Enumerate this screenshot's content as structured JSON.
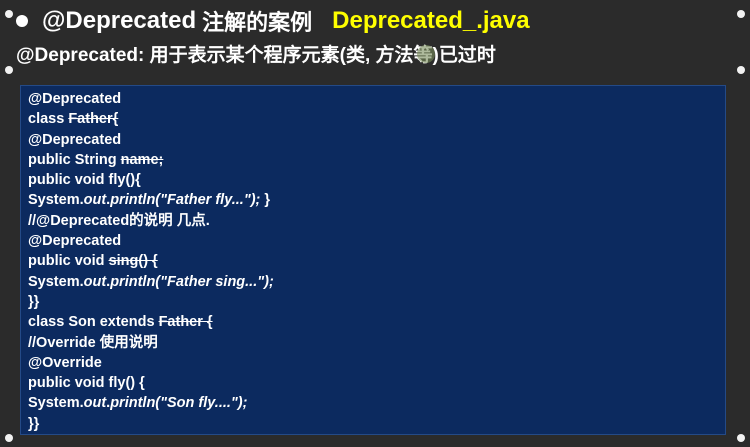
{
  "header": {
    "title_main": "@Deprecated",
    "title_cn": "注解的案例",
    "title_file": "Deprecated_.java",
    "subtitle_prefix": "@Deprecated:",
    "subtitle_text": "用于表示某个程序元素(类, 方法等)已过时"
  },
  "code": {
    "l1": "@Deprecated",
    "l2a": "class ",
    "l2b": "Father{",
    "l3": "@Deprecated",
    "l4a": "public String ",
    "l4b": "name;",
    "l5": "public void fly(){",
    "l6a": "System.",
    "l6b": "out",
    "l6c": ".",
    "l6d": "println(\"Father fly...\"); ",
    "l6e": "}",
    "l7": "//@Deprecated的说明 几点.",
    "l8": "@Deprecated",
    "l9a": "public void ",
    "l9b": "sing() {",
    "l10a": "System.",
    "l10b": "out",
    "l10c": ".",
    "l10d": "println(\"Father sing...\");",
    "l11": "}}",
    "l12a": "class Son extends ",
    "l12b": "Father {",
    "l13": "//Override 使用说明",
    "l14": "@Override",
    "l15": "public void fly() {",
    "l16a": "System.",
    "l16b": "out",
    "l16c": ".",
    "l16d": "println(\"Son fly....\");",
    "l17": "}}"
  },
  "colors": {
    "background": "#2b2b2b",
    "code_background": "#0c2a5f",
    "accent_yellow": "#ffff00",
    "text": "#ffffff"
  }
}
